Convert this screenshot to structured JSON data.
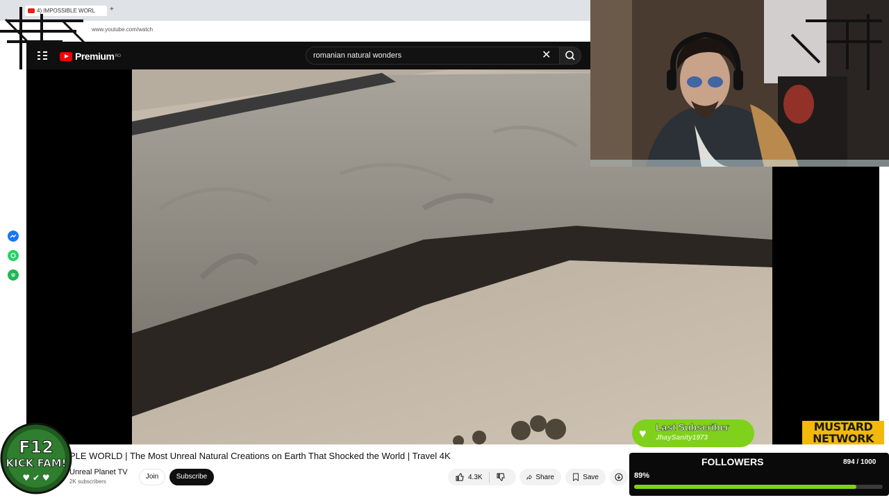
{
  "browser": {
    "tab_title": "4) IMPOSSIBLE WORL",
    "new_tab": "+",
    "url": "www.youtube.com/watch"
  },
  "youtube": {
    "logo_text": "Premium",
    "region": "RO",
    "search_query": "romanian natural wonders",
    "clear_icon": "✕"
  },
  "video": {
    "title": "PLE WORLD | The Most Unreal Natural Creations on Earth That Shocked the World | Travel 4K",
    "channel": "Unreal Planet TV",
    "subscribers": "2K subscribers",
    "join_label": "Join",
    "subscribe_label": "Subscribe",
    "likes": "4.3K",
    "share_label": "Share",
    "save_label": "Save"
  },
  "overlay": {
    "badge_line1": "F12",
    "badge_line2": "KICK FAM!",
    "last_sub_title": "Last Subscriber",
    "last_sub_name": "JhaySanity1973",
    "network_line1": "MUSTARD",
    "network_line2": "NETWORK",
    "followers_title": "FOLLOWERS",
    "followers_count": "894 / 1000",
    "followers_pct": "89%",
    "followers_progress": 0.894
  },
  "colors": {
    "yt_red": "#ff0000",
    "accent_green": "#7fd11b",
    "mustard": "#f2b90b"
  }
}
